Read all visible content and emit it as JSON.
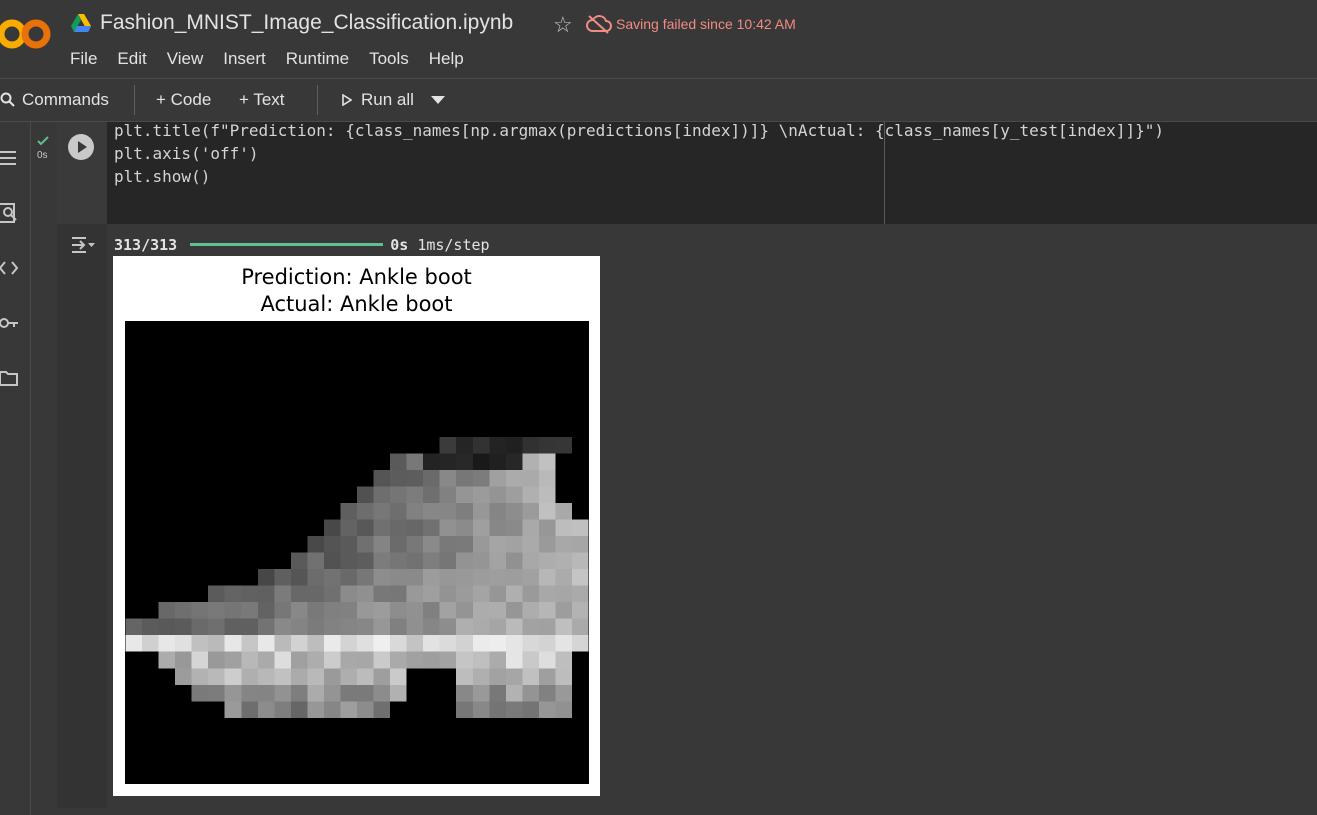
{
  "header": {
    "notebook_title": "Fashion_MNIST_Image_Classification.ipynb",
    "save_status": "Saving failed since 10:42 AM",
    "icons": [
      "colab-logo-icon",
      "drive-icon",
      "star-icon",
      "cloud-off-icon"
    ]
  },
  "menu": [
    "File",
    "Edit",
    "View",
    "Insert",
    "Runtime",
    "Tools",
    "Help"
  ],
  "toolbar": {
    "commands": "Commands",
    "add_code": "+ Code",
    "add_text": "+ Text",
    "run_all": "Run all"
  },
  "cell": {
    "status": "0s",
    "code_line1": "plt.title(f\"Prediction: {class_names[np.argmax(predictions[index])]} \\nActual: {class_names[y_test[index]]}\")",
    "code_line2": "plt.axis('off')",
    "code_line3": "plt.show()"
  },
  "output": {
    "steps": "313/313",
    "time": "0s",
    "rate": "1ms/step",
    "prediction_title": "Prediction: Ankle boot",
    "actual_title": "Actual: Ankle boot"
  },
  "colors": {
    "accent_green": "#5fbf8f",
    "save_error": "#f28b82",
    "background": "#383838"
  }
}
